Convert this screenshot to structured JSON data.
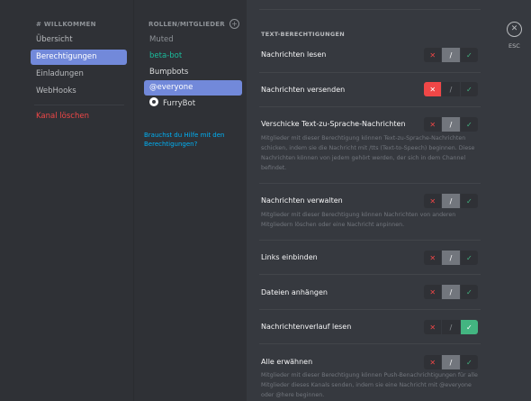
{
  "nav": {
    "header": "# WILLKOMMEN",
    "items": [
      "Übersicht",
      "Berechtigungen",
      "Einladungen",
      "WebHooks"
    ],
    "delete": "Kanal löschen"
  },
  "roles": {
    "header": "ROLLEN/MITGLIEDER",
    "items": [
      "Muted",
      "beta-bot",
      "Bumpbots",
      "@everyone",
      "FurryBot"
    ],
    "help": "Brauchst du Hilfe mit den Berechtigungen?"
  },
  "close": {
    "icon": "close-icon",
    "label": "ESC"
  },
  "main": {
    "section_title": "TEXT-BERECHTIGUNGEN",
    "perms": [
      {
        "name": "Nachrichten lesen",
        "desc": "",
        "state": "pass"
      },
      {
        "name": "Nachrichten versenden",
        "desc": "",
        "state": "deny"
      },
      {
        "name": "Verschicke Text-zu-Sprache-Nachrichten",
        "desc": "Mitglieder mit dieser Berechtigung können Text-zu-Sprache-Nachrichten schicken, indem sie die Nachricht mit /tts (Text-to-Speech) beginnen. Diese Nachrichten können von jedem gehört werden, der sich in dem Channel befindet.",
        "state": "pass"
      },
      {
        "name": "Nachrichten verwalten",
        "desc": "Mitglieder mit dieser Berechtigung können Nachrichten von anderen Mitgliedern löschen oder eine Nachricht anpinnen.",
        "state": "pass"
      },
      {
        "name": "Links einbinden",
        "desc": "",
        "state": "pass"
      },
      {
        "name": "Dateien anhängen",
        "desc": "",
        "state": "pass"
      },
      {
        "name": "Nachrichtenverlauf lesen",
        "desc": "",
        "state": "allow"
      },
      {
        "name": "Alle erwähnen",
        "desc": "Mitglieder mit dieser Berechtigung können Push-Benachrichtigungen für alle Mitglieder dieses Kanals senden, indem sie eine Nachricht mit @everyone oder @here beginnen.",
        "state": "pass"
      }
    ]
  },
  "colors": {
    "accent": "#7289da",
    "deny": "#f04747",
    "allow": "#43b581"
  }
}
